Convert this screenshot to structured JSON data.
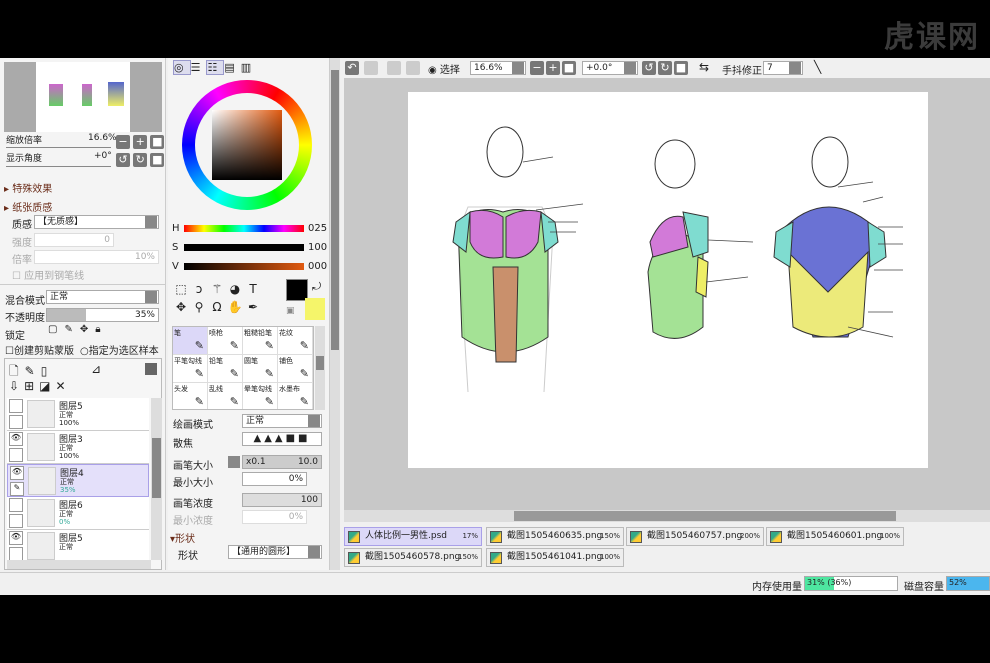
{
  "watermark": "虎课网",
  "navigator": {
    "zoom_label": "缩放倍率",
    "zoom_value": "16.6%",
    "angle_label": "显示角度",
    "angle_value": "+0°"
  },
  "effects": {
    "special_effects": "特殊效果",
    "paper_texture": "纸张质感",
    "texture_label": "质感",
    "texture_value": "【无质感】",
    "strength_label": "强度",
    "strength_value": "0",
    "scale_label": "倍率",
    "scale_value": "10%",
    "apply_linework": "应用到钢笔线"
  },
  "layer_props": {
    "blend_label": "混合模式",
    "blend_value": "正常",
    "opacity_label": "不透明度",
    "opacity_value": "35%",
    "opacity_fraction": 0.35,
    "lock_label": "锁定",
    "clip_label": "创建剪贴蒙版",
    "selection_source_label": "指定为选区样本"
  },
  "layers": [
    {
      "name": "图层5",
      "mode": "正常",
      "opacity": "100%",
      "visible": false,
      "selected": false
    },
    {
      "name": "图层3",
      "mode": "正常",
      "opacity": "100%",
      "visible": true,
      "selected": false
    },
    {
      "name": "图层4",
      "mode": "正常",
      "opacity": "35%",
      "visible": true,
      "selected": true
    },
    {
      "name": "图层6",
      "mode": "正常",
      "opacity": "0%",
      "visible": false,
      "selected": false
    },
    {
      "name": "图层5",
      "mode": "正常",
      "opacity": "",
      "visible": true,
      "selected": false
    }
  ],
  "color": {
    "h_label": "H",
    "h_value": "025",
    "s_label": "S",
    "s_value": "100",
    "v_label": "V",
    "v_value": "000",
    "primary": "#000000",
    "secondary": "#f5f56a"
  },
  "brushes": [
    [
      "笔",
      "喷枪",
      "粗糙铅笔",
      "花纹"
    ],
    [
      "平笔勾线",
      "铅笔",
      "圆笔",
      "铺色"
    ],
    [
      "头发",
      "乱线",
      "晕笔勾线",
      "水墨布"
    ]
  ],
  "brush_props": {
    "draw_mode_label": "绘画模式",
    "draw_mode_value": "正常",
    "blur_label": "散焦",
    "size_label": "画笔大小",
    "size_mult": "x0.1",
    "size_value": "10.0",
    "min_size_label": "最小大小",
    "min_size_value": "0%",
    "density_label": "画笔浓度",
    "density_value": "100",
    "min_density_label": "最小浓度",
    "min_density_value": "0%",
    "shape_section": "形状",
    "shape_label": "形状",
    "shape_value": "【通用的圆形】"
  },
  "toolbar": {
    "select_label": "选择",
    "zoom_value": "16.6%",
    "angle_value": "+0.0°",
    "stabilizer_label": "手抖修正",
    "stabilizer_value": "7"
  },
  "tabs": [
    {
      "name": "人体比例一男性.psd",
      "zoom": "17%",
      "active": true
    },
    {
      "name": "截图1505460635.png",
      "zoom": "150%",
      "active": false
    },
    {
      "name": "截图1505460757.png",
      "zoom": "200%",
      "active": false
    },
    {
      "name": "截图1505460601.png",
      "zoom": "100%",
      "active": false
    },
    {
      "name": "截图1505460578.png",
      "zoom": "150%",
      "active": false
    },
    {
      "name": "截图1505461041.png",
      "zoom": "100%",
      "active": false
    }
  ],
  "status": {
    "memory_label": "内存使用量",
    "memory_value": "31% (36%)",
    "memory_fraction": 0.31,
    "disk_label": "磁盘容量",
    "disk_value": "52%",
    "disk_fraction": 0.52
  }
}
